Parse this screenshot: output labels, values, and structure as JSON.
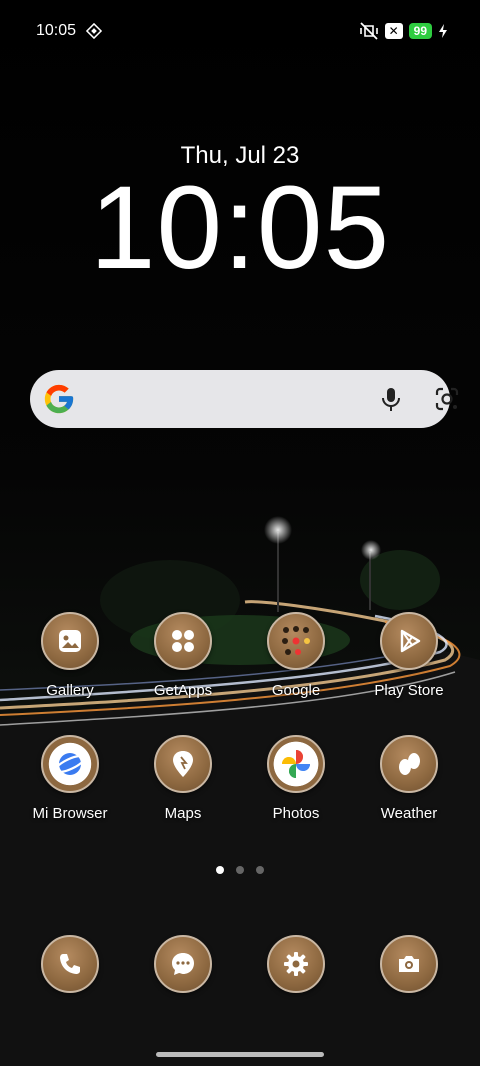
{
  "status_bar": {
    "time": "10:05",
    "battery": "99"
  },
  "lockclock": {
    "date": "Thu, Jul 23",
    "time": "10:05"
  },
  "search_bar": {
    "icons": [
      "google-g-icon",
      "microphone-icon",
      "google-lens-icon"
    ]
  },
  "apps_row1": [
    {
      "label": "Gallery",
      "icon": "gallery-icon"
    },
    {
      "label": "GetApps",
      "icon": "getapps-icon"
    },
    {
      "label": "Google",
      "icon": "google-folder"
    },
    {
      "label": "Play Store",
      "icon": "play-store-icon"
    }
  ],
  "apps_row2": [
    {
      "label": "Mi Browser",
      "icon": "mi-browser-icon"
    },
    {
      "label": "Maps",
      "icon": "maps-icon"
    },
    {
      "label": "Photos",
      "icon": "photos-icon"
    },
    {
      "label": "Weather",
      "icon": "weather-icon"
    }
  ],
  "page_indicator": {
    "pages": 3,
    "active_page": 1
  },
  "dock": [
    {
      "icon": "phone-icon"
    },
    {
      "icon": "messages-icon"
    },
    {
      "icon": "settings-icon"
    },
    {
      "icon": "camera-icon"
    }
  ],
  "colors": {
    "icon_bronze": "#8d6840",
    "battery_green": "#2ecc40",
    "search_bg": "#e6e6e9"
  }
}
